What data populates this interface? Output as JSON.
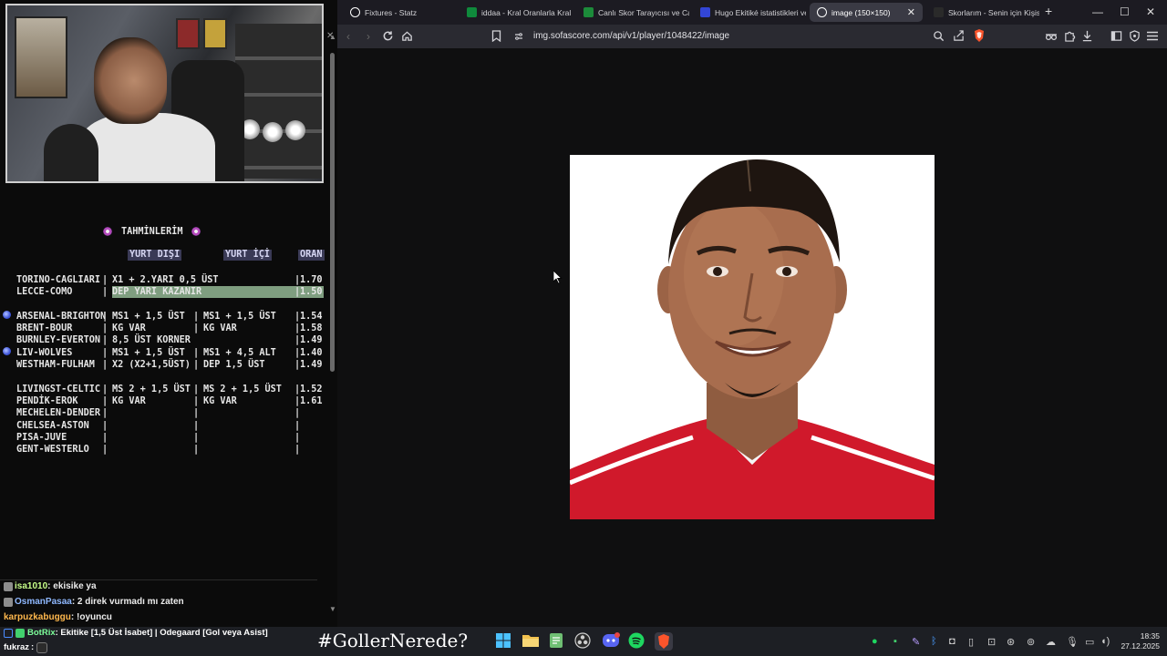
{
  "browser": {
    "tabs": [
      {
        "title": "Fixtures - Statz",
        "icon": "globe-icon",
        "color": "#ffffff",
        "active": false
      },
      {
        "title": "iddaa - Kral Oranlarla Kral",
        "icon": "iddaa-icon",
        "color": "#0f8a3c",
        "active": false
      },
      {
        "title": "Canlı Skor Tarayıcısı ve Can",
        "icon": "flashscore-icon",
        "color": "#1c8b3a",
        "active": false
      },
      {
        "title": "Hugo Ekitiké istatistikleri ve",
        "icon": "sofascore-icon",
        "color": "#3346d6",
        "active": false
      },
      {
        "title": "image (150×150)",
        "icon": "globe-icon",
        "color": "#ffffff",
        "active": true
      },
      {
        "title": "Skorlarım - Senin için Kişis",
        "icon": "365-icon",
        "color": "#2a2a2a",
        "active": false
      }
    ],
    "new_tab": "+",
    "url": "img.sofascore.com/api/v1/player/1048422/image"
  },
  "overlay": {
    "predictions_title": "TAHMİNLERİM",
    "col_abroad": "YURT DIŞI",
    "col_domestic": "YURT İÇİ",
    "col_odds": "ORAN",
    "rows": [
      {
        "match": "TORINO-CAGLIARI",
        "abroad": "X1 + 2.YARI 0,5 ÜST",
        "domestic": "",
        "odds": "1.70",
        "highlight": false,
        "bullet": false,
        "merged": true
      },
      {
        "match": "LECCE-COMO",
        "abroad": "DEP YARI KAZANIR",
        "domestic": "",
        "odds": "1.50",
        "highlight": true,
        "bullet": false,
        "merged": true
      },
      {
        "match": "ARSENAL-BRIGHTON",
        "abroad": "MS1 + 1,5 ÜST",
        "domestic": "MS1 + 1,5 ÜST",
        "odds": "1.54",
        "highlight": false,
        "bullet": true,
        "merged": false
      },
      {
        "match": "BRENT-BOUR",
        "abroad": "KG VAR",
        "domestic": "KG VAR",
        "odds": "1.58",
        "highlight": false,
        "bullet": false,
        "merged": false
      },
      {
        "match": "BURNLEY-EVERTON",
        "abroad": "8,5 ÜST KORNER",
        "domestic": "",
        "odds": "1.49",
        "highlight": false,
        "bullet": false,
        "merged": true
      },
      {
        "match": "LIV-WOLVES",
        "abroad": "MS1 + 1,5 ÜST",
        "domestic": "MS1 + 4,5 ALT",
        "odds": "1.40",
        "highlight": false,
        "bullet": true,
        "merged": false
      },
      {
        "match": "WESTHAM-FULHAM",
        "abroad": "X2 (X2+1,5ÜST)",
        "domestic": "DEP 1,5 ÜST",
        "odds": "1.49",
        "highlight": false,
        "bullet": false,
        "merged": false
      },
      {
        "match": "LIVINGST-CELTIC",
        "abroad": "MS 2 + 1,5 ÜST",
        "domestic": "MS 2 + 1,5 ÜST",
        "odds": "1.52",
        "highlight": false,
        "bullet": false,
        "merged": false
      },
      {
        "match": "PENDİK-EROK",
        "abroad": "KG VAR",
        "domestic": "KG VAR",
        "odds": "1.61",
        "highlight": false,
        "bullet": false,
        "merged": false
      },
      {
        "match": "MECHELEN-DENDER",
        "abroad": "",
        "domestic": "",
        "odds": "",
        "highlight": false,
        "bullet": false,
        "merged": false
      },
      {
        "match": "CHELSEA-ASTON",
        "abroad": "",
        "domestic": "",
        "odds": "",
        "highlight": false,
        "bullet": false,
        "merged": false
      },
      {
        "match": "PISA-JUVE",
        "abroad": "",
        "domestic": "",
        "odds": "",
        "highlight": false,
        "bullet": false,
        "merged": false
      },
      {
        "match": "GENT-WESTERLO",
        "abroad": "",
        "domestic": "",
        "odds": "",
        "highlight": false,
        "bullet": false,
        "merged": false
      }
    ],
    "chat": [
      {
        "user": "isa1010",
        "message": ": ekisike ya",
        "color": "#c8ff8a"
      },
      {
        "user": "OsmanPasaa",
        "message": ": 2 direk vurmadı mı zaten",
        "color": "#8fb8ff"
      },
      {
        "user": "karpuzkabuggu",
        "message": ": !oyuncu",
        "color": "#ffb84d"
      }
    ],
    "bot_user": "BotRix",
    "bot_message": ": Ekitike [1,5 Üst İsabet] | Odegaard [Gol veya Asist]",
    "last_user": "fukraz",
    "last_message": ":",
    "hashtag": "#GollerNerede?"
  },
  "taskbar": {
    "time": "18:35",
    "date": "27.12.2025"
  },
  "colors": {
    "tabbar": "#1c1b22",
    "toolbar": "#2a2a31",
    "highlight_row": "#7f9e80",
    "header_chip": "#3a3a56",
    "jersey_red": "#d0192b"
  }
}
